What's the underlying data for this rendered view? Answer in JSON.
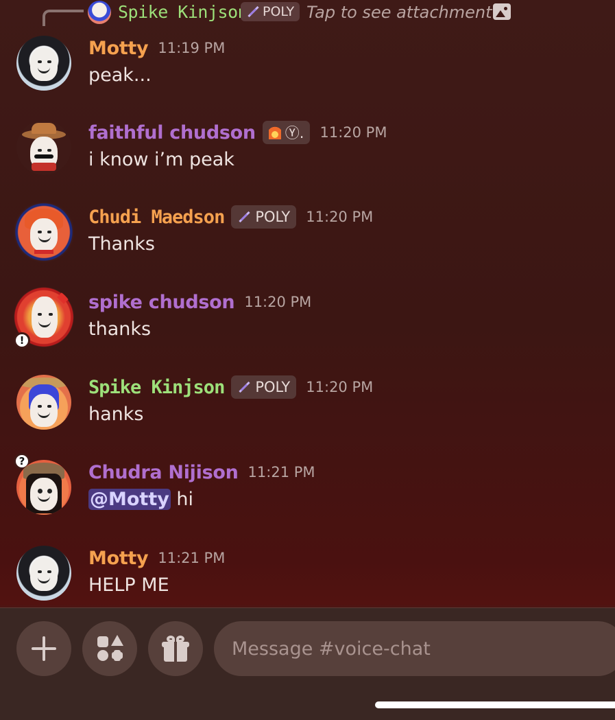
{
  "reply": {
    "author": "Spike Kinjson",
    "tag": "POLY",
    "text": "Tap to see attachment"
  },
  "messages": [
    {
      "author": "Motty",
      "time": "11:19 PM",
      "text": "peak...",
      "name_color": "#f5a14f"
    },
    {
      "author": "faithful chudson",
      "tag": "Ⓨ.",
      "time": "11:20 PM",
      "text": "i know i’m peak",
      "name_color": "#b06fcf"
    },
    {
      "author": "Chudi Maedson",
      "tag": "POLY",
      "time": "11:20 PM",
      "text": "Thanks",
      "name_color": "#f5a14f"
    },
    {
      "author": "spike chudson",
      "time": "11:20 PM",
      "text": "thanks",
      "name_color": "#b06fcf"
    },
    {
      "author": "Spike Kinjson",
      "tag": "POLY",
      "time": "11:20 PM",
      "text": "hanks",
      "name_color": "#9de07a"
    },
    {
      "author": "Chudra Nijison",
      "time": "11:21 PM",
      "mention": "@Motty",
      "text": " hi",
      "name_color": "#b06fcf"
    },
    {
      "author": "Motty",
      "time": "11:21 PM",
      "text": "HELP ME",
      "name_color": "#f5a14f"
    }
  ],
  "composer": {
    "placeholder": "Message #voice-chat"
  },
  "icons": {
    "add": "plus-icon",
    "apps": "apps-icon",
    "gift": "gift-icon",
    "attachment": "image-icon",
    "tag": "sword-icon",
    "fire": "fire-icon"
  }
}
